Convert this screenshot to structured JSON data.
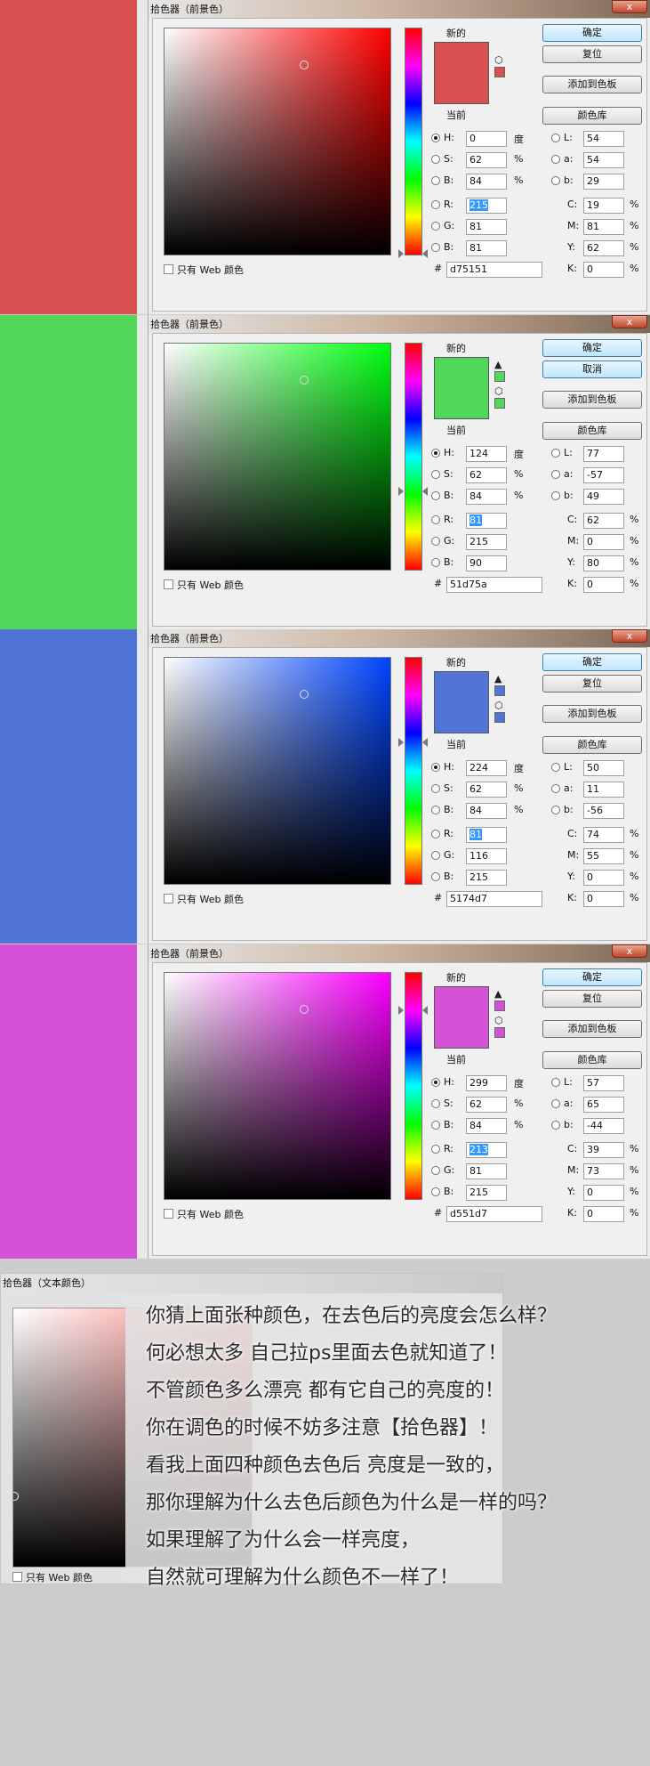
{
  "dialog_title": "拾色器（前景色）",
  "close_symbol": "x",
  "labels": {
    "new": "新的",
    "current": "当前",
    "H": "H:",
    "S": "S:",
    "B": "B:",
    "R": "R:",
    "G": "G:",
    "B2": "B:",
    "L": "L:",
    "a": "a:",
    "b": "b:",
    "C": "C:",
    "M": "M:",
    "Y": "Y:",
    "K": "K:",
    "degree": "度",
    "percent": "%",
    "hash": "#",
    "web_only": "只有 Web 颜色"
  },
  "buttons": {
    "ok": "确定",
    "reset": "复位",
    "cancel": "取消",
    "add_swatch": "添加到色板",
    "library": "颜色库"
  },
  "pickers": [
    {
      "color": "#d75151",
      "hue_color": "#ff0000",
      "second_button": "复位",
      "warning": false,
      "H": "0",
      "S": "62",
      "B": "84",
      "R": "215",
      "G": "81",
      "Bv": "81",
      "L": "54",
      "a": "54",
      "b": "29",
      "C": "19",
      "M": "81",
      "Y": "62",
      "K": "0",
      "hex": "d75151"
    },
    {
      "color": "#51d75a",
      "hue_color": "#00ff0f",
      "second_button": "取消",
      "warning": true,
      "H": "124",
      "S": "62",
      "B": "84",
      "R": "81",
      "G": "215",
      "Bv": "90",
      "L": "77",
      "a": "-57",
      "b": "49",
      "C": "62",
      "M": "0",
      "Y": "80",
      "K": "0",
      "hex": "51d75a"
    },
    {
      "color": "#5174d7",
      "hue_color": "#0044ff",
      "second_button": "复位",
      "warning": true,
      "H": "224",
      "S": "62",
      "B": "84",
      "R": "81",
      "G": "116",
      "Bv": "215",
      "L": "50",
      "a": "11",
      "b": "-56",
      "C": "74",
      "M": "55",
      "Y": "0",
      "K": "0",
      "hex": "5174d7"
    },
    {
      "color": "#d551d7",
      "hue_color": "#fb00ff",
      "second_button": "复位",
      "warning": true,
      "H": "299",
      "S": "62",
      "B": "84",
      "R": "213",
      "G": "81",
      "Bv": "215",
      "L": "57",
      "a": "65",
      "b": "-44",
      "C": "39",
      "M": "73",
      "Y": "0",
      "K": "0",
      "hex": "d551d7"
    }
  ],
  "text_dialog": {
    "title": "拾色器（文本颜色）",
    "web_only": "只有 Web 颜色"
  },
  "caption_lines": [
    "你猜上面张种颜色，在去色后的亮度会怎么样？",
    "何必想太多 自己拉ps里面去色就知道了！",
    "不管颜色多么漂亮 都有它自己的亮度的！",
    "你在调色的时候不妨多注意【拾色器】！",
    "看我上面四种颜色去色后 亮度是一致的，",
    "那你理解为什么去色后颜色为什么是一样的吗？",
    "如果理解了为什么会一样亮度，",
    "自然就可理解为什么颜色不一样了！"
  ]
}
